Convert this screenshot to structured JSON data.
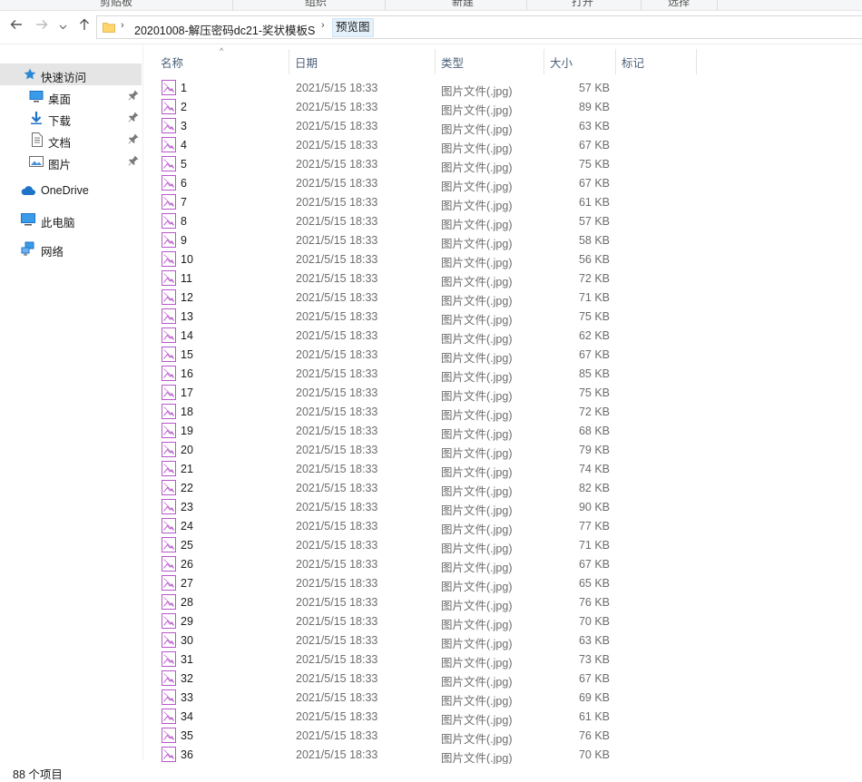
{
  "ribbon": {
    "groups": [
      {
        "label": "剪贴板"
      },
      {
        "label": "组织"
      },
      {
        "label": "新建"
      },
      {
        "label": "打开"
      },
      {
        "label": "选择"
      }
    ]
  },
  "addressbar": {
    "back_icon": "arrow-left-icon",
    "forward_icon": "arrow-right-icon",
    "recent_icon": "chevron-down-icon",
    "up_icon": "arrow-up-icon",
    "crumbs": [
      {
        "label": "20201008-解压密码dc21-奖状模板S"
      },
      {
        "label": "预览图"
      }
    ]
  },
  "nav": {
    "items": [
      {
        "label": "快速访问",
        "icon": "star-icon"
      },
      {
        "label": "桌面",
        "icon": "desktop-icon"
      },
      {
        "label": "下载",
        "icon": "download-icon"
      },
      {
        "label": "文档",
        "icon": "document-icon"
      },
      {
        "label": "图片",
        "icon": "pictures-icon"
      },
      {
        "label": "OneDrive",
        "icon": "cloud-icon"
      },
      {
        "label": "此电脑",
        "icon": "computer-icon"
      },
      {
        "label": "网络",
        "icon": "network-icon"
      }
    ]
  },
  "columns": {
    "name": "名称",
    "date": "日期",
    "type": "类型",
    "size": "大小",
    "tags": "标记"
  },
  "files": [
    {
      "name": "1",
      "date": "2021/5/15 18:33",
      "type": "图片文件(.jpg)",
      "size": "57 KB"
    },
    {
      "name": "2",
      "date": "2021/5/15 18:33",
      "type": "图片文件(.jpg)",
      "size": "89 KB"
    },
    {
      "name": "3",
      "date": "2021/5/15 18:33",
      "type": "图片文件(.jpg)",
      "size": "63 KB"
    },
    {
      "name": "4",
      "date": "2021/5/15 18:33",
      "type": "图片文件(.jpg)",
      "size": "67 KB"
    },
    {
      "name": "5",
      "date": "2021/5/15 18:33",
      "type": "图片文件(.jpg)",
      "size": "75 KB"
    },
    {
      "name": "6",
      "date": "2021/5/15 18:33",
      "type": "图片文件(.jpg)",
      "size": "67 KB"
    },
    {
      "name": "7",
      "date": "2021/5/15 18:33",
      "type": "图片文件(.jpg)",
      "size": "61 KB"
    },
    {
      "name": "8",
      "date": "2021/5/15 18:33",
      "type": "图片文件(.jpg)",
      "size": "57 KB"
    },
    {
      "name": "9",
      "date": "2021/5/15 18:33",
      "type": "图片文件(.jpg)",
      "size": "58 KB"
    },
    {
      "name": "10",
      "date": "2021/5/15 18:33",
      "type": "图片文件(.jpg)",
      "size": "56 KB"
    },
    {
      "name": "11",
      "date": "2021/5/15 18:33",
      "type": "图片文件(.jpg)",
      "size": "72 KB"
    },
    {
      "name": "12",
      "date": "2021/5/15 18:33",
      "type": "图片文件(.jpg)",
      "size": "71 KB"
    },
    {
      "name": "13",
      "date": "2021/5/15 18:33",
      "type": "图片文件(.jpg)",
      "size": "75 KB"
    },
    {
      "name": "14",
      "date": "2021/5/15 18:33",
      "type": "图片文件(.jpg)",
      "size": "62 KB"
    },
    {
      "name": "15",
      "date": "2021/5/15 18:33",
      "type": "图片文件(.jpg)",
      "size": "67 KB"
    },
    {
      "name": "16",
      "date": "2021/5/15 18:33",
      "type": "图片文件(.jpg)",
      "size": "85 KB"
    },
    {
      "name": "17",
      "date": "2021/5/15 18:33",
      "type": "图片文件(.jpg)",
      "size": "75 KB"
    },
    {
      "name": "18",
      "date": "2021/5/15 18:33",
      "type": "图片文件(.jpg)",
      "size": "72 KB"
    },
    {
      "name": "19",
      "date": "2021/5/15 18:33",
      "type": "图片文件(.jpg)",
      "size": "68 KB"
    },
    {
      "name": "20",
      "date": "2021/5/15 18:33",
      "type": "图片文件(.jpg)",
      "size": "79 KB"
    },
    {
      "name": "21",
      "date": "2021/5/15 18:33",
      "type": "图片文件(.jpg)",
      "size": "74 KB"
    },
    {
      "name": "22",
      "date": "2021/5/15 18:33",
      "type": "图片文件(.jpg)",
      "size": "82 KB"
    },
    {
      "name": "23",
      "date": "2021/5/15 18:33",
      "type": "图片文件(.jpg)",
      "size": "90 KB"
    },
    {
      "name": "24",
      "date": "2021/5/15 18:33",
      "type": "图片文件(.jpg)",
      "size": "77 KB"
    },
    {
      "name": "25",
      "date": "2021/5/15 18:33",
      "type": "图片文件(.jpg)",
      "size": "71 KB"
    },
    {
      "name": "26",
      "date": "2021/5/15 18:33",
      "type": "图片文件(.jpg)",
      "size": "67 KB"
    },
    {
      "name": "27",
      "date": "2021/5/15 18:33",
      "type": "图片文件(.jpg)",
      "size": "65 KB"
    },
    {
      "name": "28",
      "date": "2021/5/15 18:33",
      "type": "图片文件(.jpg)",
      "size": "76 KB"
    },
    {
      "name": "29",
      "date": "2021/5/15 18:33",
      "type": "图片文件(.jpg)",
      "size": "70 KB"
    },
    {
      "name": "30",
      "date": "2021/5/15 18:33",
      "type": "图片文件(.jpg)",
      "size": "63 KB"
    },
    {
      "name": "31",
      "date": "2021/5/15 18:33",
      "type": "图片文件(.jpg)",
      "size": "73 KB"
    },
    {
      "name": "32",
      "date": "2021/5/15 18:33",
      "type": "图片文件(.jpg)",
      "size": "67 KB"
    },
    {
      "name": "33",
      "date": "2021/5/15 18:33",
      "type": "图片文件(.jpg)",
      "size": "69 KB"
    },
    {
      "name": "34",
      "date": "2021/5/15 18:33",
      "type": "图片文件(.jpg)",
      "size": "61 KB"
    },
    {
      "name": "35",
      "date": "2021/5/15 18:33",
      "type": "图片文件(.jpg)",
      "size": "76 KB"
    },
    {
      "name": "36",
      "date": "2021/5/15 18:33",
      "type": "图片文件(.jpg)",
      "size": "70 KB"
    }
  ],
  "status": {
    "item_count": "88 个项目"
  },
  "colors": {
    "selected_bg": "#cce8ff",
    "header_text": "#4c607a",
    "image_icon": "#b557c9",
    "folder_yellow": "#ffd66b",
    "accent_blue": "#1e72c8"
  }
}
